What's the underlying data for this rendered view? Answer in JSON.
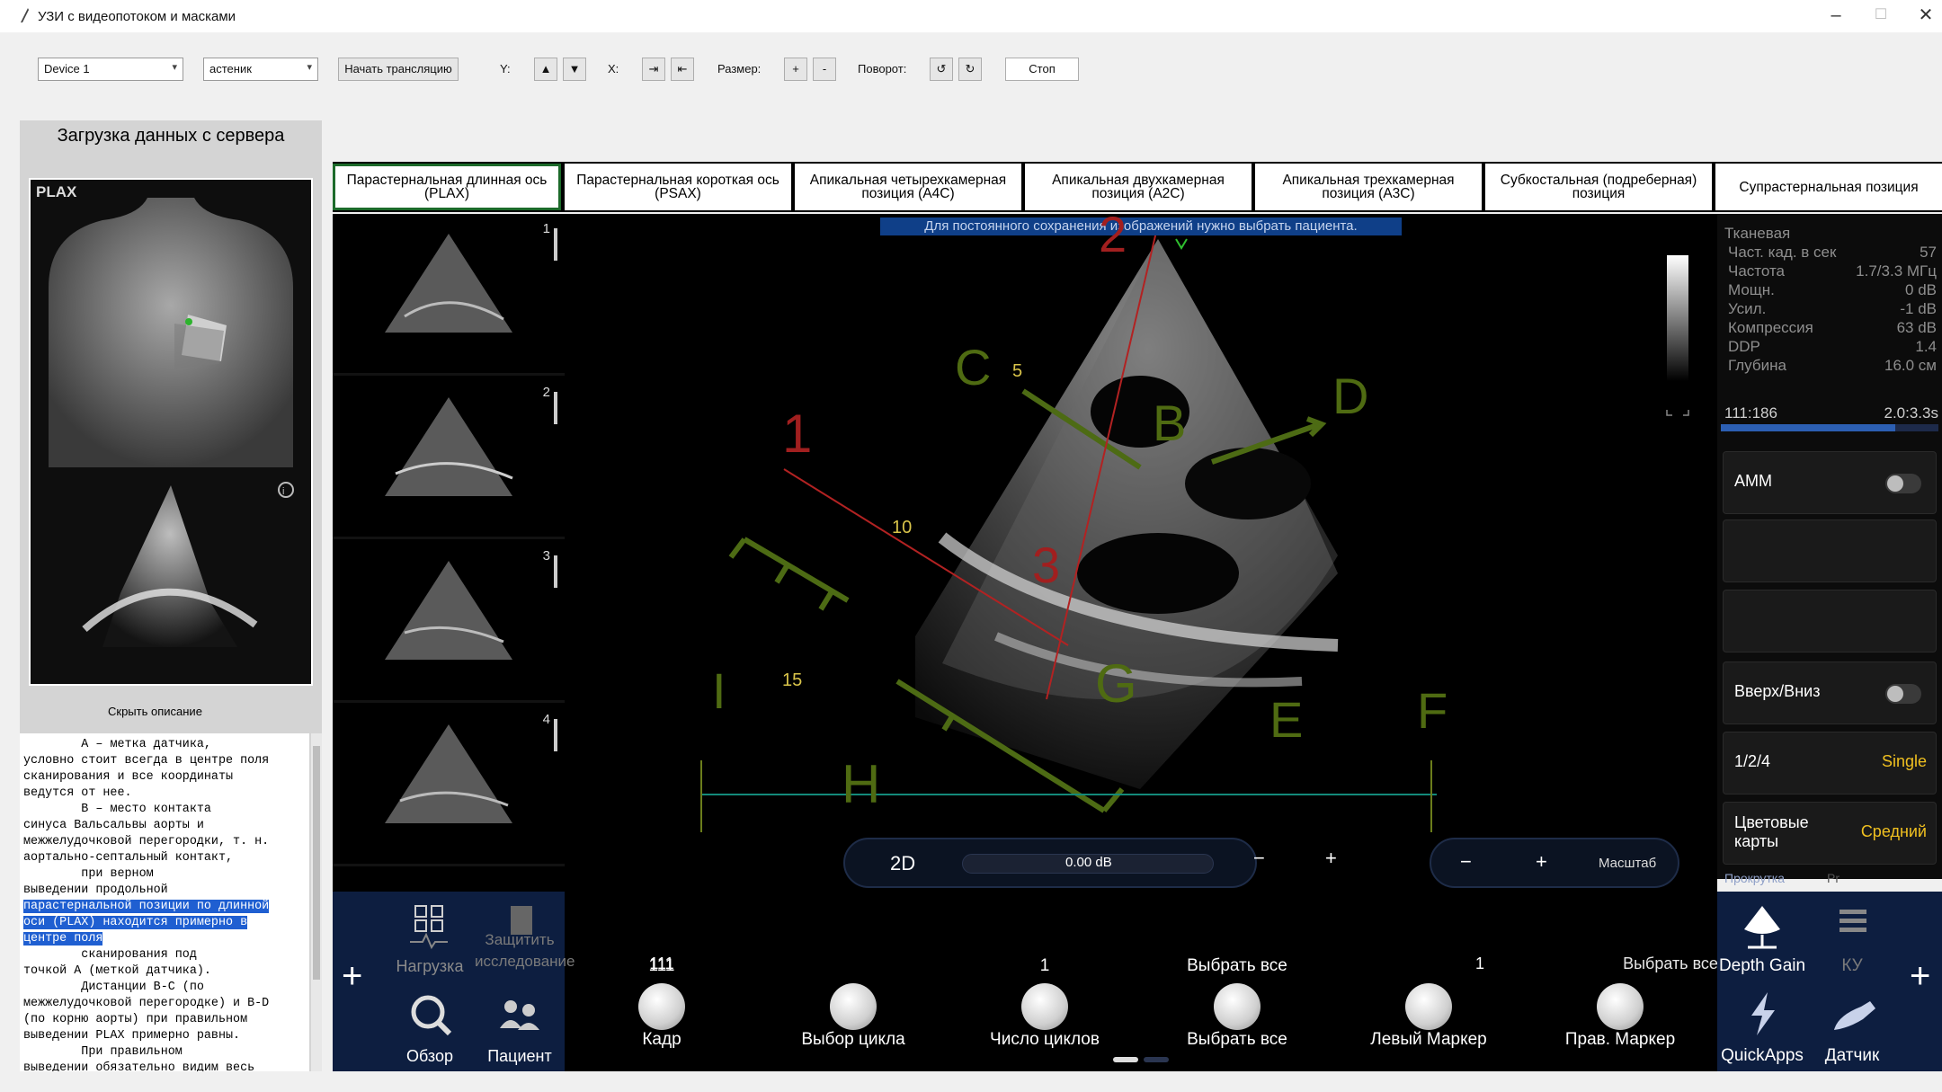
{
  "window": {
    "title": "УЗИ с видеопотоком и масками",
    "minimize": "–",
    "maximize": "☐",
    "close": "✕"
  },
  "toolbar": {
    "device_select": "Device 1",
    "body_type_select": "астеник",
    "start_stream": "Начать трансляцию",
    "y_label": "Y:",
    "y_up": "▲",
    "y_down": "▼",
    "x_label": "X:",
    "x_left": "⇥",
    "x_right": "⇤",
    "size_label": "Размер:",
    "size_plus": "+",
    "size_minus": "-",
    "rotate_label": "Поворот:",
    "rotate_ccw": "↺",
    "rotate_cw": "↻",
    "stop": "Стоп"
  },
  "left_panel": {
    "title": "Загрузка данных с сервера",
    "image_label": "PLAX",
    "hide_description": "Скрыть описание",
    "description_before": "        А – метка датчика,\nусловно стоит всегда в центре поля\nсканирования и все координаты\nведутся от нее.\n        В – место контакта\nсинуса Вальсальвы аорты и\nмежжелудочковой перегородки, т. н.\nаортально-септальный контакт,\n        при верном\nвыведении продольной",
    "description_highlight": "\nпарастернальной позиции по длинной\nоси (PLAX) находится примерно в\nцентре поля",
    "description_after": "\n        сканирования под\nточкой А (меткой датчика).\n        Дистанции В-С (по\nмежжелудочковой перегородке) и В-D\n(по корню аорты) при правильном\nвыведении PLAX примерно равны.\n        При правильном\nвыведении обязательно видим весь"
  },
  "tabs": [
    {
      "label": "Парастернальная длинная ось (PLAX)"
    },
    {
      "label": "Парастернальная короткая ось (PSAX)"
    },
    {
      "label": "Апикальная четырехкамерная позиция (А4С)"
    },
    {
      "label": "Апикальная двухкамерная позиция (А2С)"
    },
    {
      "label": "Апикальная трехкамерная позиция (А3С)"
    },
    {
      "label": "Субкостальная (подреберная) позиция"
    },
    {
      "label": "Супрастернальная позиция"
    }
  ],
  "thumbnails": [
    {
      "num": "1"
    },
    {
      "num": "2"
    },
    {
      "num": "3"
    },
    {
      "num": "4"
    }
  ],
  "viewer": {
    "banner": "Для постоянного сохранения изображений нужно выбрать пациента.",
    "markers": {
      "1": "1",
      "2": "2",
      "3": "3",
      "B": "B",
      "C": "C",
      "D": "D",
      "E": "E",
      "F": "F",
      "G": "G",
      "H": "H",
      "I": "I",
      "d5": "5",
      "d10": "10",
      "d15": "15"
    },
    "mode": "2D",
    "gain_value": "0.00 dB",
    "gain_minus": "−",
    "gain_plus": "+",
    "zoom_minus": "−",
    "zoom_plus": "+",
    "zoom_label": "Масштаб"
  },
  "info_panel": {
    "preset": "Тканевая",
    "rows": [
      {
        "label": "Част. кад. в сек",
        "value": "57"
      },
      {
        "label": "Частота",
        "value": "1.7/3.3 МГц"
      },
      {
        "label": "Мощн.",
        "value": "0 dB"
      },
      {
        "label": "Усил.",
        "value": "-1 dB"
      },
      {
        "label": "Компрессия",
        "value": "63 dB"
      },
      {
        "label": "DDP",
        "value": "1.4"
      },
      {
        "label": "Глубина",
        "value": "16.0 см"
      }
    ],
    "cine_frames": "111:186",
    "cine_time": "2.0:3.3s",
    "cine_progress": 0.8,
    "amm": "АММ",
    "updown": "Вверх/Вниз",
    "layout": "1/2/4",
    "layout_value": "Single",
    "color_maps": "Цветовые карты",
    "color_maps_value": "Средний",
    "scroll_tab": "Прокрутка",
    "pr_tab": "Pr"
  },
  "bottom": {
    "left_grid": {
      "load": "Нагрузка",
      "protect": "Защитить исследование",
      "review": "Обзор",
      "patient": "Пациент",
      "add": "+"
    },
    "knobs": [
      {
        "top": "111",
        "label": "Кадр"
      },
      {
        "top": "",
        "label": "Выбор цикла"
      },
      {
        "top": "1",
        "label": "Число циклов"
      },
      {
        "top": "Выбрать все",
        "label": "Выбрать все"
      },
      {
        "top": "",
        "label": "Левый Маркер"
      },
      {
        "top": "",
        "label": "Прав. Маркер"
      }
    ],
    "right_grid": {
      "depth_gain": "Depth Gain",
      "ku": "КУ",
      "quickapps": "QuickApps",
      "probe": "Датчик",
      "add": "+"
    }
  }
}
